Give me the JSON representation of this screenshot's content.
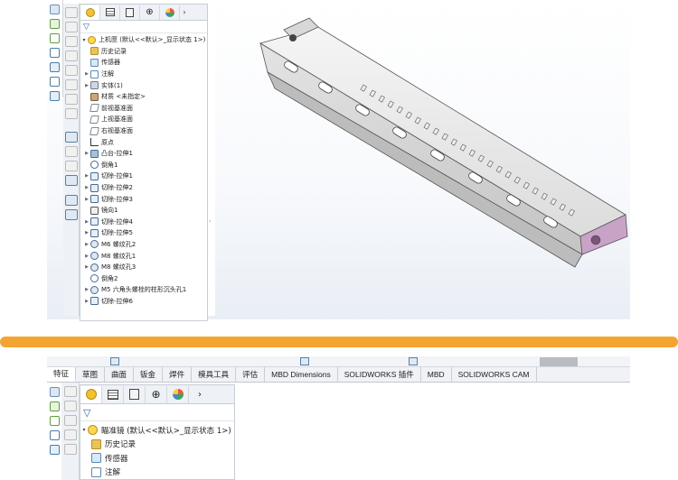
{
  "top": {
    "root_label": "上机匣  (默认<<默认>_显示状态 1>)",
    "items": [
      {
        "label": "历史记录",
        "icon": "folder-icon",
        "arrow": ""
      },
      {
        "label": "传感器",
        "icon": "sensor-icon",
        "arrow": ""
      },
      {
        "label": "注解",
        "icon": "annotation-icon",
        "arrow": "▶"
      },
      {
        "label": "实体(1)",
        "icon": "solid-body-icon",
        "arrow": "▶"
      },
      {
        "label": "材质 <未指定>",
        "icon": "material-icon",
        "arrow": ""
      },
      {
        "label": "前视基准面",
        "icon": "plane-icon",
        "arrow": ""
      },
      {
        "label": "上视基准面",
        "icon": "plane-icon",
        "arrow": ""
      },
      {
        "label": "右视基准面",
        "icon": "plane-icon",
        "arrow": ""
      },
      {
        "label": "原点",
        "icon": "origin-icon",
        "arrow": ""
      },
      {
        "label": "凸台-拉伸1",
        "icon": "boss-extrude-icon",
        "arrow": "▶"
      },
      {
        "label": "倒角1",
        "icon": "chamfer-icon",
        "arrow": ""
      },
      {
        "label": "切除-拉伸1",
        "icon": "cut-extrude-icon",
        "arrow": "▶"
      },
      {
        "label": "切除-拉伸2",
        "icon": "cut-extrude-icon",
        "arrow": "▶"
      },
      {
        "label": "切除-拉伸3",
        "icon": "cut-extrude-icon",
        "arrow": "▶"
      },
      {
        "label": "镜向1",
        "icon": "mirror-icon",
        "arrow": ""
      },
      {
        "label": "切除-拉伸4",
        "icon": "cut-extrude-icon",
        "arrow": "▶"
      },
      {
        "label": "切除-拉伸5",
        "icon": "cut-extrude-icon",
        "arrow": "▶"
      },
      {
        "label": "M6 螺纹孔2",
        "icon": "hole-icon",
        "arrow": "▶"
      },
      {
        "label": "M8 螺纹孔1",
        "icon": "hole-icon",
        "arrow": "▶"
      },
      {
        "label": "M8 螺纹孔3",
        "icon": "hole-icon",
        "arrow": "▶"
      },
      {
        "label": "倒角2",
        "icon": "chamfer-icon",
        "arrow": ""
      },
      {
        "label": "M5 六角头螺栓的柱形沉头孔1",
        "icon": "hole-icon",
        "arrow": "▶"
      },
      {
        "label": "切除-拉伸6",
        "icon": "cut-extrude-icon",
        "arrow": "▶"
      }
    ]
  },
  "bottom": {
    "tabs": [
      "特征",
      "草图",
      "曲面",
      "钣金",
      "焊件",
      "模具工具",
      "评估",
      "MBD Dimensions",
      "SOLIDWORKS 插件",
      "MBD",
      "SOLIDWORKS CAM"
    ],
    "root_label": "瞄准镜  (默认<<默认>_显示状态 1>)",
    "items": [
      {
        "label": "历史记录",
        "icon": "folder-icon"
      },
      {
        "label": "传感器",
        "icon": "sensor-icon"
      },
      {
        "label": "注解",
        "icon": "annotation-icon"
      }
    ]
  },
  "colors": {
    "divider": "#f4a431",
    "part_body": "#e6e6e6",
    "part_end": "#c9a3c7"
  }
}
